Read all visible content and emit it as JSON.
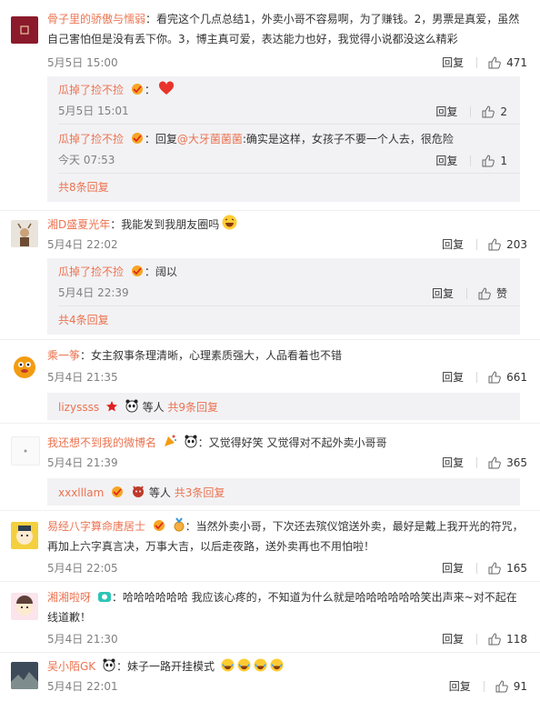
{
  "reply_label": "回复",
  "praise_label": "赞",
  "comments": [
    {
      "user": "骨子里的骄傲与懦弱",
      "text": "：看完这个几点总结1，外卖小哥不容易啊，为了赚钱。2，男票是真爱，虽然自己害怕但是没有丢下你。3，博主真可爱，表达能力也好，我觉得小说都没这么精彩",
      "time": "5月5日 15:00",
      "likes": "471",
      "replies": [
        {
          "user": "瓜掉了捡不捡",
          "text": "：",
          "time": "5月5日 15:01",
          "likes": "2"
        },
        {
          "user": "瓜掉了捡不捡",
          "prefix": "：回复",
          "at": "@大牙菌菌菌",
          "text": ":确实是这样，女孩子不要一个人去，很危险",
          "time": "今天 07:53",
          "likes": "1"
        }
      ],
      "more": "共8条回复"
    },
    {
      "user": "湘D盛夏光年",
      "text": "：我能发到我朋友圈吗",
      "time": "5月4日 22:02",
      "likes": "203",
      "replies": [
        {
          "user": "瓜掉了捡不捡",
          "text": "：阔以",
          "time": "5月4日 22:39",
          "likes": "赞"
        }
      ],
      "more": "共4条回复"
    },
    {
      "user": "乘一筝",
      "text": "：女主叙事条理清晰，心理素质强大，人品看着也不错",
      "time": "5月4日 21:35",
      "likes": "661",
      "summary": {
        "user": "lizyssss",
        "mid": "等人",
        "link": "共9条回复"
      }
    },
    {
      "user": "我还想不到我的微博名",
      "text": "：又觉得好笑 又觉得对不起外卖小哥哥",
      "time": "5月4日 21:39",
      "likes": "365",
      "summary": {
        "user": "xxxlllam",
        "mid": "等人",
        "link": "共3条回复"
      }
    },
    {
      "user": "易经八字算命唐居士",
      "text": "：当然外卖小哥，下次还去殡仪馆送外卖，最好是戴上我开光的符咒，再加上六字真言决，万事大吉，以后走夜路，送外卖再也不用怕啦！",
      "time": "5月4日 22:05",
      "likes": "165"
    },
    {
      "user": "湘湘啦呀",
      "text": "：哈哈哈哈哈哈 我应该心疼的，不知道为什么就是哈哈哈哈哈哈笑出声来~对不起在线道歉！",
      "time": "5月4日 21:30",
      "likes": "118"
    },
    {
      "user": "吴小陌GK",
      "text": "：妹子一路开挂模式",
      "time": "5月4日 22:01",
      "likes": "91"
    }
  ]
}
